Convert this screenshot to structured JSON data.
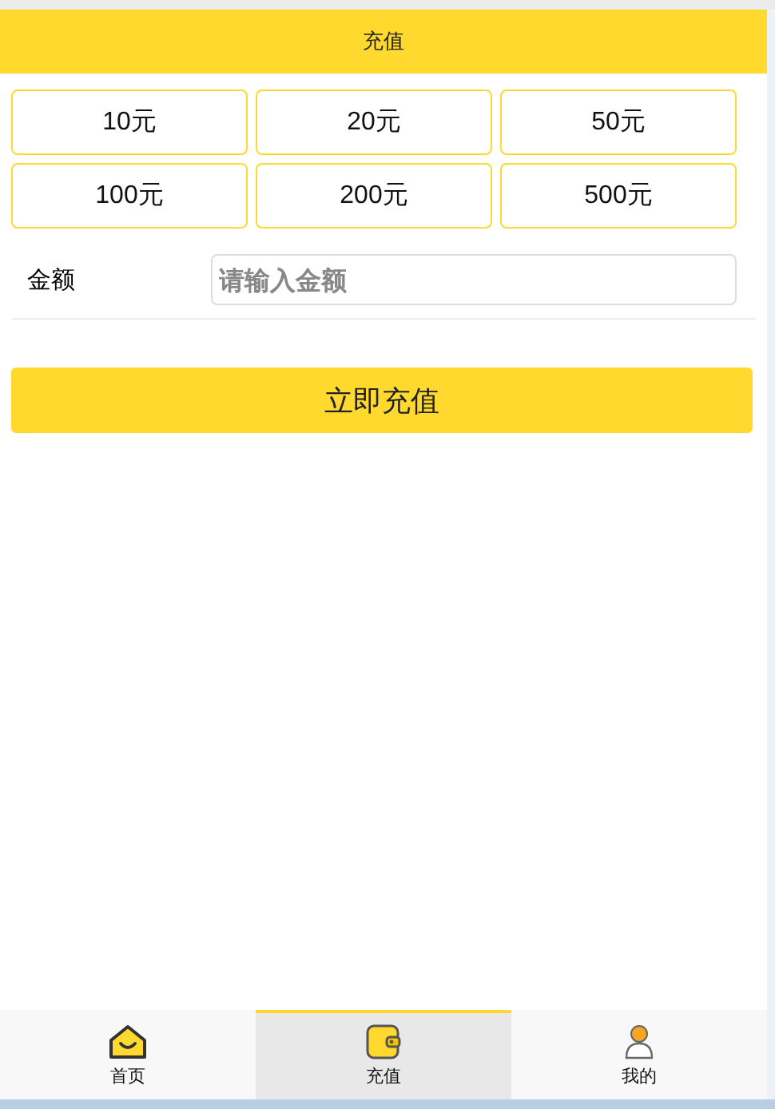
{
  "header": {
    "title": "充值"
  },
  "amounts": [
    "10元",
    "20元",
    "50元",
    "100元",
    "200元",
    "500元"
  ],
  "amount_field": {
    "label": "金额",
    "placeholder": "请输入金额"
  },
  "submit_button": "立即充值",
  "tab_bar": [
    {
      "label": "首页",
      "kind": "home",
      "selected": false
    },
    {
      "label": "充值",
      "kind": "wallet",
      "selected": true
    },
    {
      "label": "我的",
      "kind": "user",
      "selected": false
    }
  ]
}
